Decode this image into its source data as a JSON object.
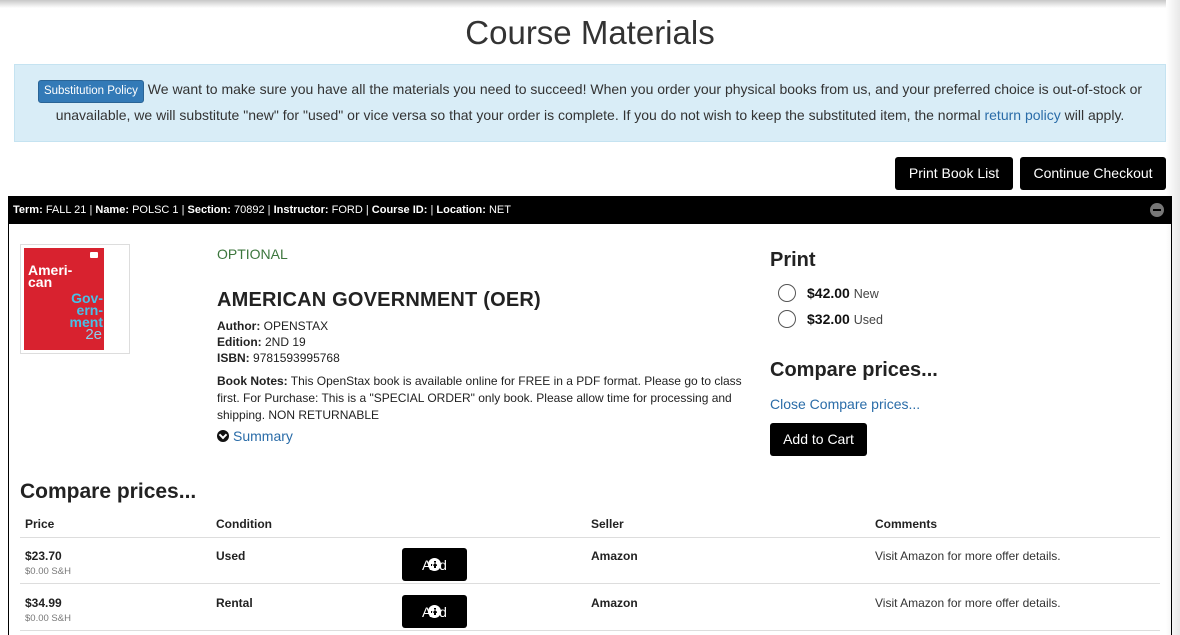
{
  "page": {
    "title": "Course Materials"
  },
  "policy": {
    "badge": "Substitution Policy",
    "text": " We want to make sure you have all the materials you need to succeed! When you order your physical books from us, and your preferred choice is out-of-stock or unavailable, we will substitute \"new\" for \"used\" or vice versa so that your order is complete. If you do not wish to keep the substituted item, the normal ",
    "link": "return policy",
    "suffix": " will apply."
  },
  "toolbar": {
    "print_list": "Print Book List",
    "continue_checkout": "Continue Checkout"
  },
  "course": {
    "term_label": "Term:",
    "term": "FALL 21",
    "name_label": "Name:",
    "name": "POLSC 1",
    "section_label": "Section:",
    "section": "70892",
    "instructor_label": "Instructor:",
    "instructor": "FORD",
    "course_id_label": "Course ID:",
    "course_id": "",
    "location_label": "Location:",
    "location": "NET"
  },
  "book": {
    "cover": {
      "line1": "Ameri-",
      "line2": "can",
      "line3": "Gov-",
      "line4": "ern-",
      "line5": "ment",
      "edition_mark": "2e"
    },
    "requirement": "OPTIONAL",
    "title": "AMERICAN GOVERNMENT (OER)",
    "author_label": "Author:",
    "author": "OPENSTAX",
    "edition_label": "Edition:",
    "edition": "2ND 19",
    "isbn_label": "ISBN:",
    "isbn": "9781593995768",
    "notes_label": "Book Notes:",
    "notes": "This OpenStax book is available online for FREE in a PDF format. Please go to class first. For Purchase: This is a \"SPECIAL ORDER\" only book. Please allow time for processing and shipping. NON RETURNABLE",
    "summary_link": "Summary"
  },
  "print_options": {
    "heading": "Print",
    "options": [
      {
        "price": "$42.00",
        "condition": "New"
      },
      {
        "price": "$32.00",
        "condition": "Used"
      }
    ],
    "compare_heading": "Compare prices...",
    "close_compare": "Close Compare prices...",
    "add_to_cart": "Add to Cart"
  },
  "compare": {
    "heading": "Compare prices...",
    "columns": {
      "price": "Price",
      "condition": "Condition",
      "seller": "Seller",
      "comments": "Comments"
    },
    "add_label": "Add",
    "rows": [
      {
        "price": "$23.70",
        "shipping": "$0.00 S&H",
        "condition": "Used",
        "seller": "Amazon",
        "comment": "Visit Amazon for more offer details."
      },
      {
        "price": "$34.99",
        "shipping": "$0.00 S&H",
        "condition": "Rental",
        "seller": "Amazon",
        "comment": "Visit Amazon for more offer details."
      }
    ]
  },
  "colors": {
    "accent_link": "#2a6ca8",
    "policy_bg": "#d9edf7",
    "badge_bg": "#337ab7",
    "optional_green": "#3c763d",
    "button_bg": "#000000"
  }
}
